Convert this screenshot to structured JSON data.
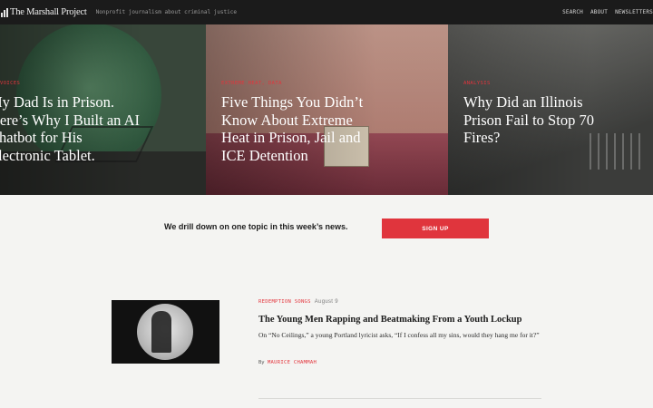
{
  "header": {
    "logo_text": "The Marshall Project",
    "tagline": "Nonprofit journalism about criminal justice",
    "nav": [
      "SEARCH",
      "ABOUT",
      "NEWSLETTERS"
    ]
  },
  "hero_cards": [
    {
      "kicker": "VOICES",
      "headline_lines": [
        "My Dad Is in Prison.",
        "Here’s Why I Built an AI",
        "Chatbot for His",
        "Electronic Tablet."
      ]
    },
    {
      "kicker": "EXTREME HEAT, DATA",
      "headline_lines": [
        "Five Things You Didn’t",
        "Know About Extreme",
        "Heat in Prison, Jail and",
        "ICE Detention"
      ]
    },
    {
      "kicker": "ANALYSIS",
      "headline_lines": [
        "Why Did an Illinois",
        "Prison Fail to Stop 70",
        "Fires?"
      ]
    }
  ],
  "signup": {
    "text": "We drill down on one topic in this week’s news.",
    "button_label": "SIGN UP"
  },
  "story": {
    "category": "REDEMPTION SONGS",
    "date": "August 9",
    "title": "The Young Men Rapping and Beatmaking From a Youth Lockup",
    "dek": "On “No Ceilings,” a young Portland lyricist asks, “If I confess all my sins, would they hang me for it?”",
    "by": "By",
    "author": "MAURICE CHAMMAH"
  },
  "colors": {
    "accent_red": "#e0353d",
    "topbar": "#1b1b1b",
    "background": "#f4f4f2"
  }
}
